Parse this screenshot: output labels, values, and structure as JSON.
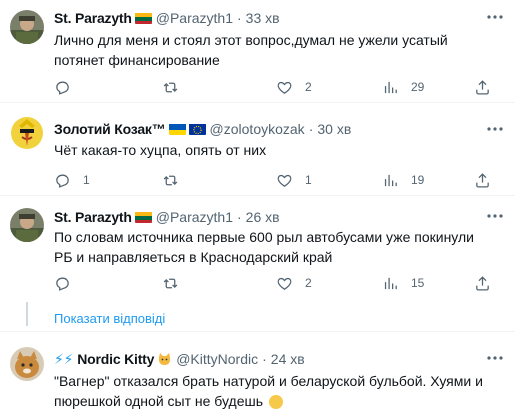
{
  "tweets": [
    {
      "user": "St. Parazyth",
      "handle": "@Parazyth1",
      "dot": "·",
      "time": "33 хв",
      "text": "Лично для меня и стоял этот вопрос,думал не ужели усатый потянет финансирование",
      "replies": "",
      "retweets": "",
      "likes": "2",
      "views": "29"
    },
    {
      "user": "Золотий Козак™",
      "handle": "@zolotoykozak",
      "dot": "·",
      "time": "30 хв",
      "text": "Чёт какая-то хуцпа, опять от них",
      "replies": "1",
      "retweets": "",
      "likes": "1",
      "views": "19"
    },
    {
      "user": "St. Parazyth",
      "handle": "@Parazyth1",
      "dot": "·",
      "time": "26 хв",
      "text": "По словам источника первые 600 рыл автобусами уже покинули РБ и направляеться в Краснодарский край",
      "replies": "",
      "retweets": "",
      "likes": "2",
      "views": "15"
    },
    {
      "user": "Nordic Kitty",
      "prefix": "⚡⚡",
      "handle": "@KittyNordic",
      "dot": "·",
      "time": "24 хв",
      "text": "\"Вагнер\" отказался брать натурой и беларуской бульбой. Хуями и пюрешкой одной сыт не будешь"
    }
  ],
  "show_replies": "Показати відповіді",
  "colors": {
    "accent": "#1d9bf0",
    "text": "#0f1419",
    "muted": "#536471",
    "divider": "#eff3f4"
  }
}
